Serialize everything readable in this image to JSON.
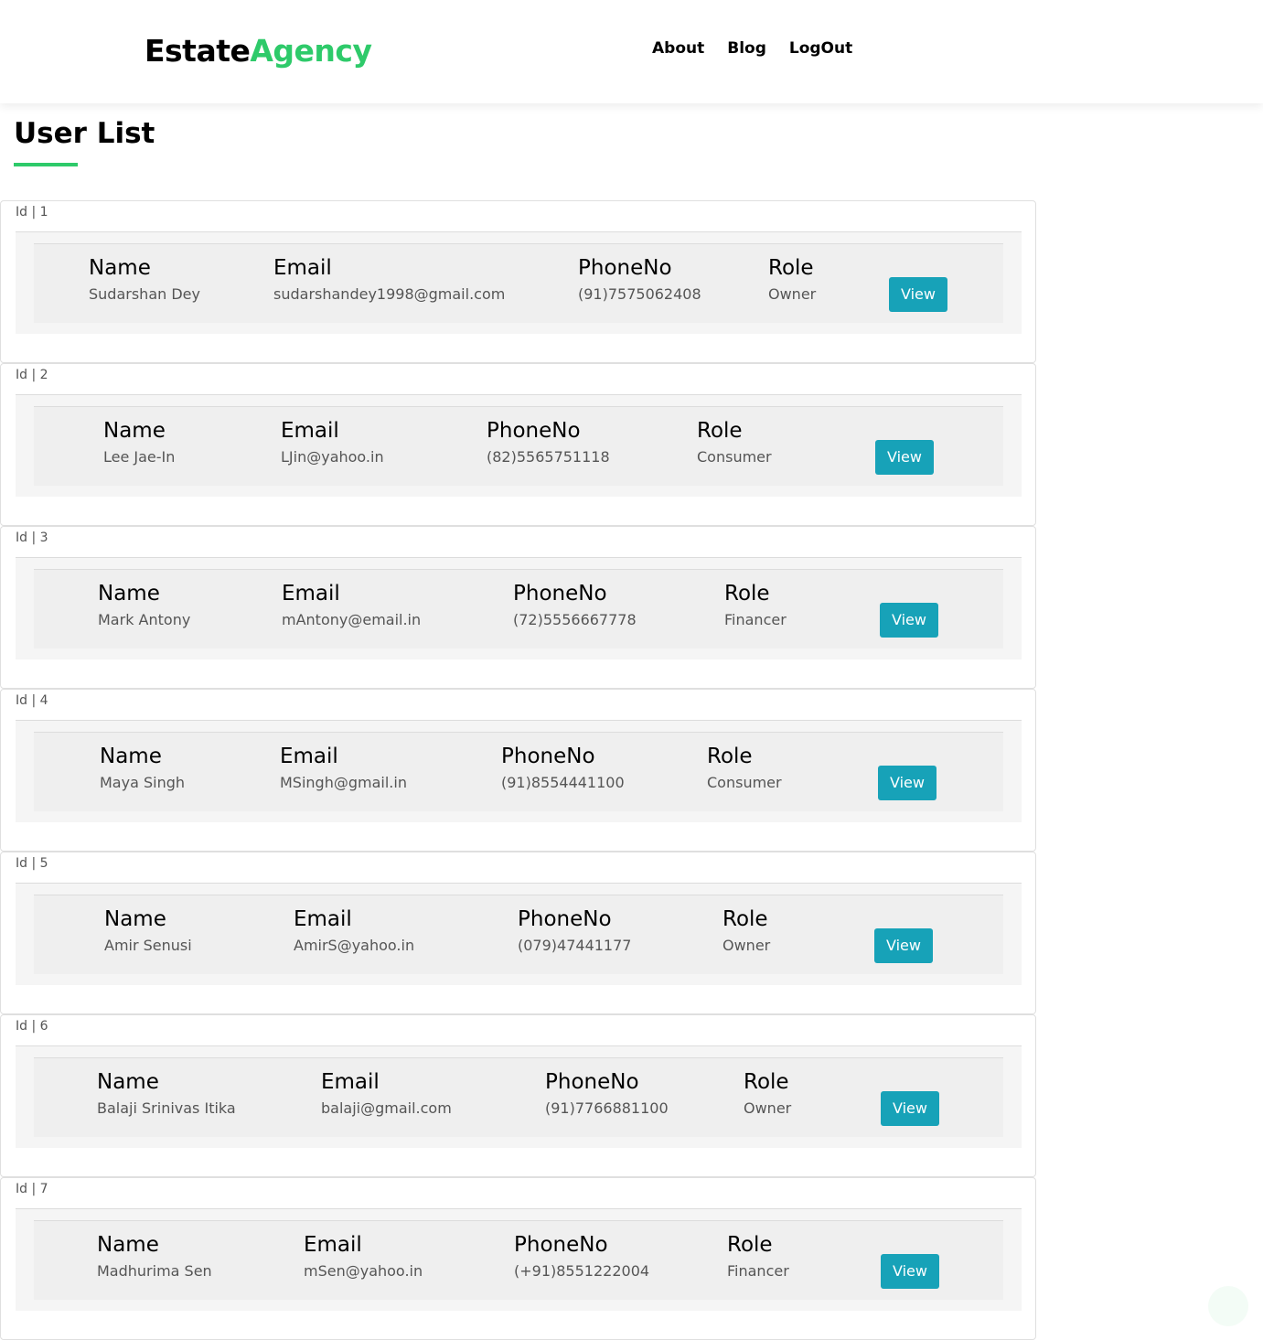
{
  "brand": {
    "part1": "Estate",
    "part2": "Agency"
  },
  "nav": {
    "links": [
      "About",
      "Blog",
      "LogOut"
    ]
  },
  "page": {
    "title": "User List"
  },
  "labels": {
    "name": "Name",
    "email": "Email",
    "phone": "PhoneNo",
    "role": "Role",
    "view": "View"
  },
  "users": [
    {
      "header": "Id | 1",
      "name": "Sudarshan Dey",
      "email": "sudarshandey1998@gmail.com",
      "phone": "(91)7575062408",
      "role": "Owner"
    },
    {
      "header": "Id | 2",
      "name": "Lee Jae-In",
      "email": "LJin@yahoo.in",
      "phone": "(82)5565751118",
      "role": "Consumer"
    },
    {
      "header": "Id | 3",
      "name": "Mark Antony",
      "email": "mAntony@email.in",
      "phone": "(72)5556667778",
      "role": "Financer"
    },
    {
      "header": "Id | 4",
      "name": "Maya Singh",
      "email": "MSingh@gmail.in",
      "phone": "(91)8554441100",
      "role": "Consumer"
    },
    {
      "header": "Id | 5",
      "name": "Amir Senusi",
      "email": "AmirS@yahoo.in",
      "phone": "(079)47441177",
      "role": "Owner"
    },
    {
      "header": "Id | 6",
      "name": "Balaji Srinivas Itika",
      "email": "balaji@gmail.com",
      "phone": "(91)7766881100",
      "role": "Owner"
    },
    {
      "header": "Id | 7",
      "name": "Madhurima Sen",
      "email": "mSen@yahoo.in",
      "phone": "(+91)8551222004",
      "role": "Financer"
    }
  ],
  "colors": {
    "accent": "#2eca6a",
    "button": "#17a2b8"
  }
}
